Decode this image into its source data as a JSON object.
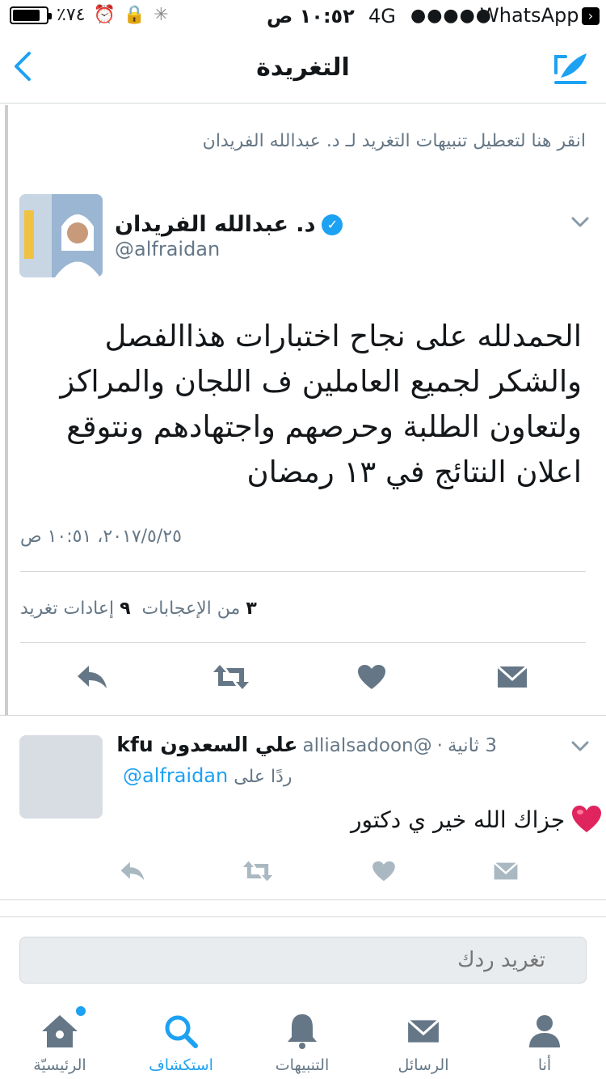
{
  "status_bar": {
    "battery": "٪٧٤",
    "time": "١٠:٥٢ ص",
    "network": "4G",
    "signal": "●●●●●",
    "back_app": "WhatsApp",
    "battery_level": 0.74
  },
  "nav": {
    "title": "التغريدة",
    "back_icon": "chevron-left-icon",
    "compose_icon": "compose-icon"
  },
  "notification": {
    "text": "انقر هنا لتعطيل تنبيهات التغريد لـ د. عبدالله الفريدان"
  },
  "tweet": {
    "author_name": "د. عبدالله الفريدان",
    "handle": "@alfraidan",
    "verified": true,
    "text": "الحمدلله على نجاح اختبارات هذاالفصل والشكر لجميع العاملين ف اللجان والمراكز ولتعاون الطلبة وحرصهم واجتهادهم ونتوقع اعلان النتائج في ١٣ رمضان",
    "timestamp": "٢٠١٧/٥/٢٥، ١٠:٥١ ص",
    "retweets_count": "٩",
    "retweets_label": "إعادات تغريد",
    "likes_count": "٣",
    "likes_label": "من الإعجابات"
  },
  "reply": {
    "author_name": "علي السعدون kfu",
    "handle": "@allialsadoon",
    "time": "3 ثانية",
    "reply_to_label": "ردًا على",
    "reply_to_handle": "alfraidan@",
    "text": "جزاك الله خير ي دكتور"
  },
  "composer": {
    "placeholder": "تغريد ردك"
  },
  "tabs": [
    {
      "label": "الرئيسيّة",
      "icon": "home-icon"
    },
    {
      "label": "استكشاف",
      "icon": "search-icon"
    },
    {
      "label": "التنبيهات",
      "icon": "bell-icon"
    },
    {
      "label": "الرسائل",
      "icon": "mail-icon"
    },
    {
      "label": "أنا",
      "icon": "person-icon"
    }
  ],
  "colors": {
    "accent": "#1da1f2",
    "secondary_text": "#657786",
    "icon_gray": "#8899a6",
    "divider": "#d5d9dc",
    "heart": "#e0245e"
  }
}
